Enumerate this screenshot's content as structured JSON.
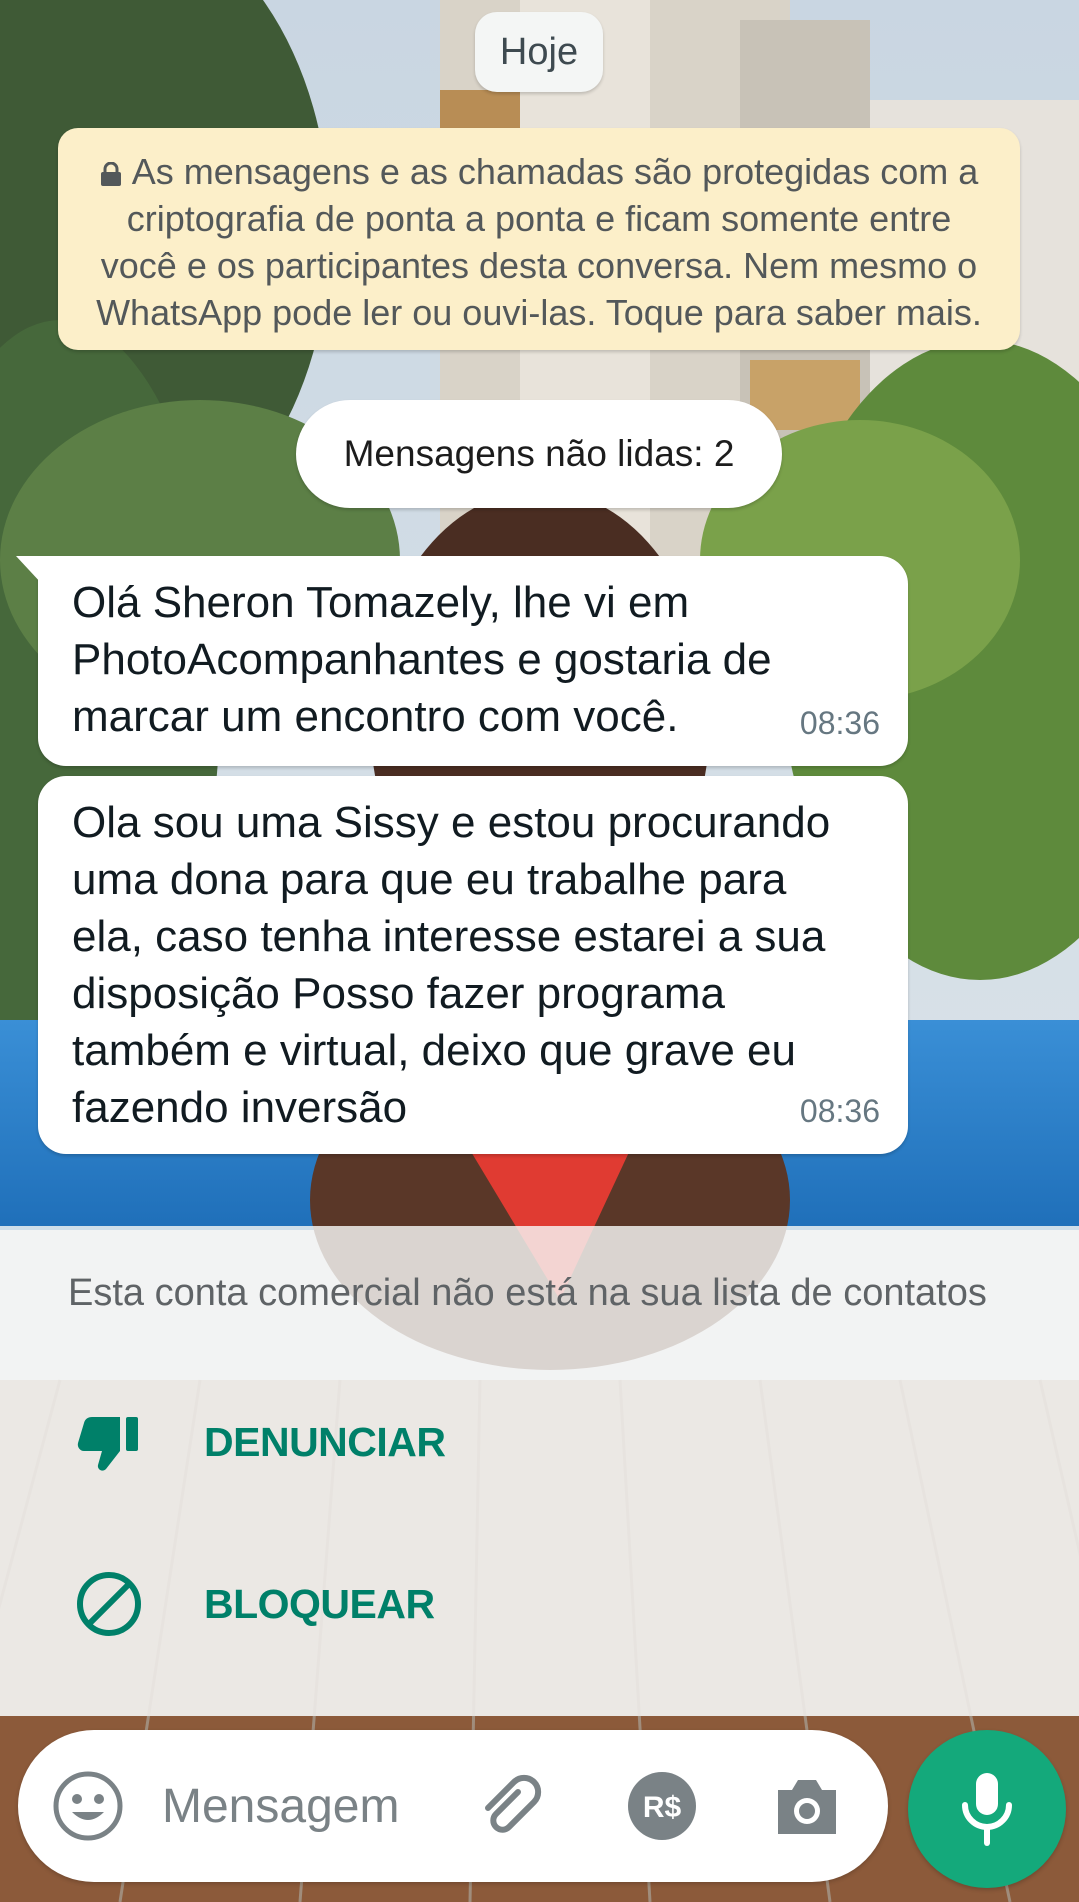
{
  "chat": {
    "date_chip": "Hoje",
    "e2e_notice": "As mensagens e as chamadas são protegidas com a criptografia de ponta a ponta e ficam somente entre você e os participantes desta conversa. Nem mesmo o WhatsApp pode ler ou ouvi-las. Toque para saber mais.",
    "unread_label": "Mensagens não lidas: 2",
    "messages": [
      {
        "text": "Olá Sheron Tomazely, lhe vi em PhotoAcompanhantes e gostaria de marcar um encontro com você.",
        "time": "08:36"
      },
      {
        "text": "Ola sou uma Sissy e estou procurando uma dona para que eu trabalhe para ela, caso tenha interesse estarei a sua disposição Posso fazer programa também e virtual, deixo que grave eu fazendo inversão",
        "time": "08:36"
      }
    ]
  },
  "contact_panel": {
    "notice": "Esta conta comercial não está na sua lista de contatos",
    "report_label": "DENUNCIAR",
    "block_label": "BLOQUEAR"
  },
  "composer": {
    "placeholder": "Mensagem"
  },
  "icons": {
    "lock": "lock-icon",
    "report": "thumbs-down-icon",
    "block": "block-icon",
    "emoji": "emoji-icon",
    "attach": "paperclip-icon",
    "payment": "payment-icon",
    "camera": "camera-icon",
    "mic": "mic-icon"
  },
  "colors": {
    "accent": "#008069",
    "mic_button": "#14a97b",
    "notice_bg": "#fcefc9",
    "bubble_bg": "#ffffff"
  }
}
